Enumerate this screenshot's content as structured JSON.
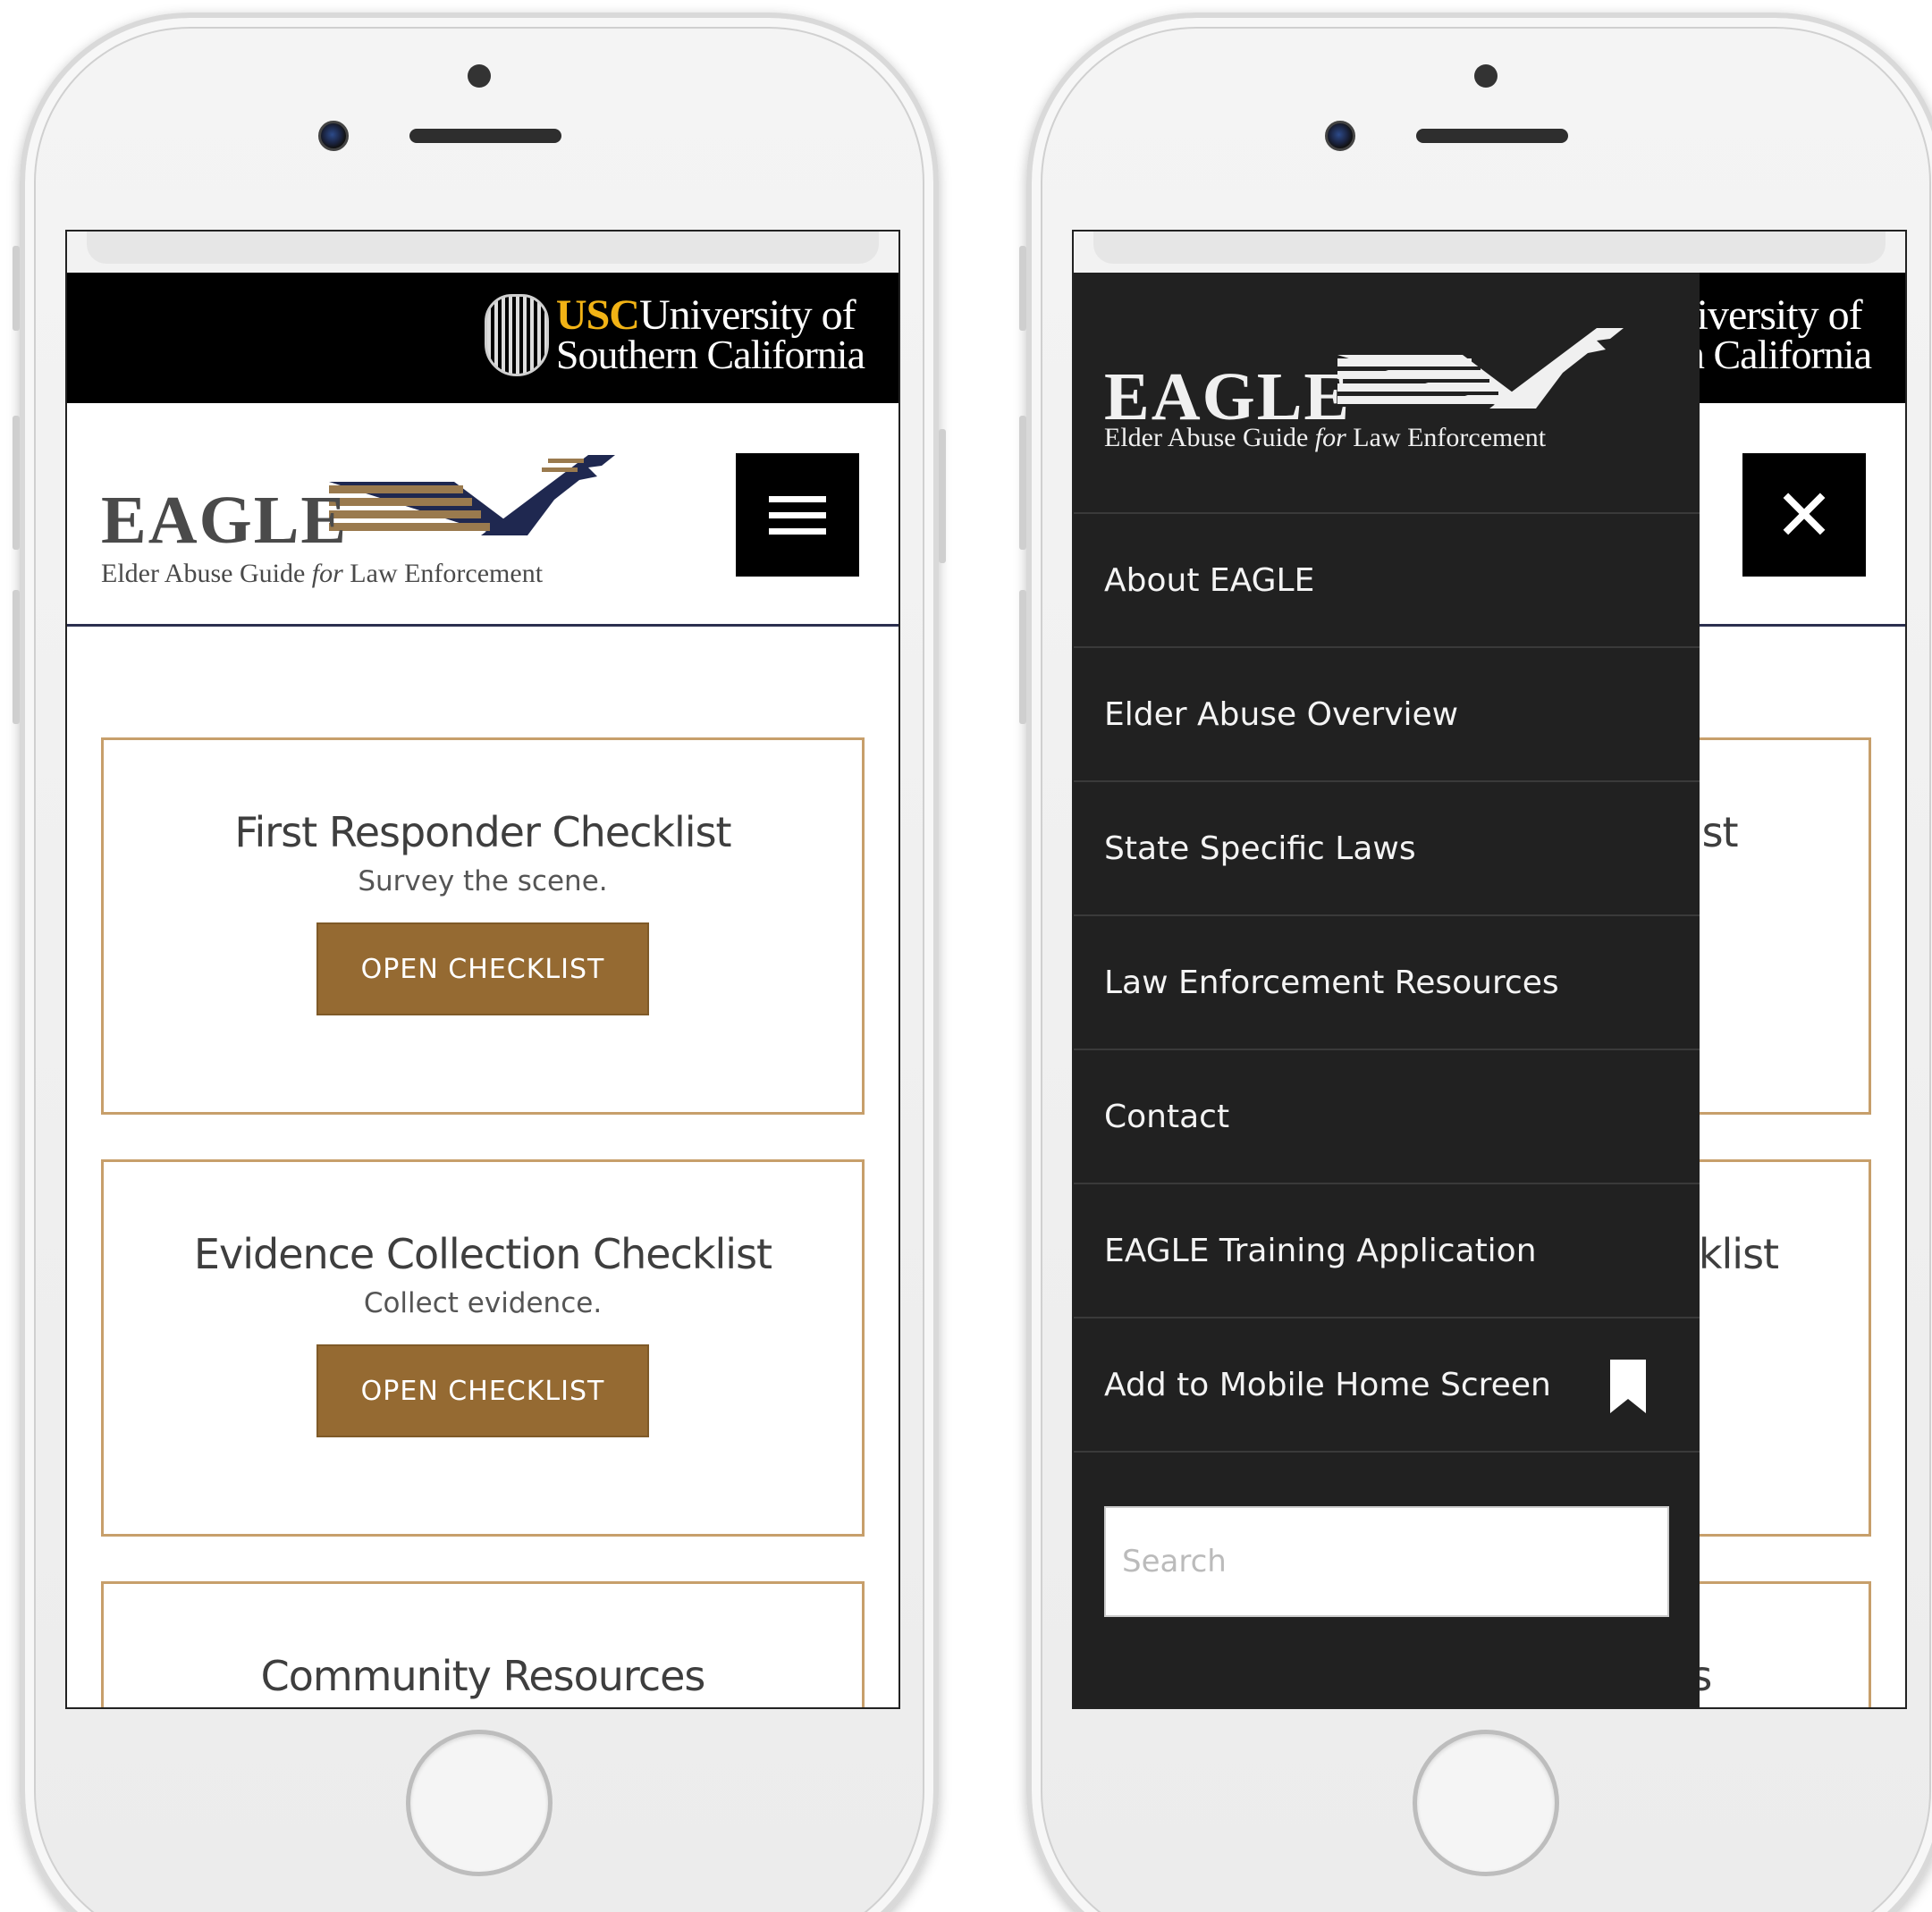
{
  "usc_banner": {
    "abbrev": "USC",
    "line1_rest": "University of",
    "line2": "Southern California",
    "brand_color": "#f2b315"
  },
  "eagle_logo": {
    "word": "EAGLE",
    "tag_before": "Elder Abuse Guide ",
    "tag_italic": "for",
    "tag_after": " Law Enforcement"
  },
  "header": {
    "menu_icon": "hamburger-icon",
    "close_icon": "close-icon",
    "close_glyph": "✕"
  },
  "cards": [
    {
      "title": "First Responder Checklist",
      "subtitle": "Survey the scene.",
      "button": "OPEN CHECKLIST"
    },
    {
      "title": "Evidence Collection Checklist",
      "subtitle": "Collect evidence.",
      "button": "OPEN CHECKLIST"
    },
    {
      "title": "Community Resources",
      "subtitle": "",
      "button": ""
    }
  ],
  "drawer": {
    "menu_items": [
      {
        "label": "About EAGLE"
      },
      {
        "label": "Elder Abuse Overview"
      },
      {
        "label": "State Specific Laws"
      },
      {
        "label": "Law Enforcement Resources"
      },
      {
        "label": "Contact"
      },
      {
        "label": "EAGLE Training Application"
      },
      {
        "label": "Add to Mobile Home Screen",
        "icon": "bookmark-icon"
      }
    ],
    "search_placeholder": "Search"
  },
  "colors": {
    "accent_brown": "#956a32",
    "card_border": "#c79f6b",
    "navy": "#1f2850",
    "drawer_bg": "#212121"
  }
}
